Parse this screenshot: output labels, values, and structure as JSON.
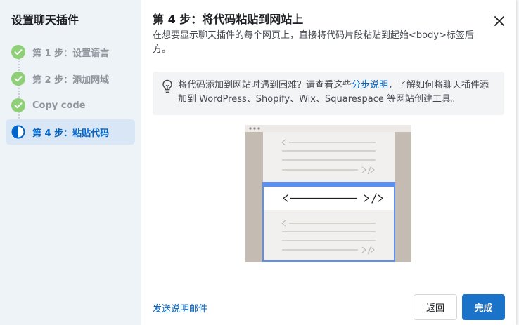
{
  "sidebar": {
    "title": "设置聊天插件",
    "steps": [
      {
        "label": "第 1 步：设置语言",
        "state": "complete"
      },
      {
        "label": "第 2 步：添加网域",
        "state": "complete"
      },
      {
        "label": "Copy code",
        "state": "complete"
      },
      {
        "label": "第 4 步：粘贴代码",
        "state": "active"
      }
    ]
  },
  "main": {
    "title": "第 4 步：将代码粘贴到网站上",
    "description": "在想要显示聊天插件的每个网页上，直接将代码片段粘贴到起始<body>标签后方。",
    "tip": {
      "text_before": "将代码添加到网站时遇到困难？请查看这些",
      "link": "分步说明",
      "text_after": "，了解如何将聊天插件添加到 WordPress、Shopify、Wix、Squarespace 等网站创建工具。"
    },
    "illustration": {
      "highlight_code": "< ———————— />"
    }
  },
  "footer": {
    "send_link": "发送说明邮件",
    "back_button": "返回",
    "done_button": "完成"
  },
  "icons": {
    "check": "check-circle-icon",
    "active": "half-circle-icon",
    "tip": "lightbulb-icon",
    "close": "close-icon"
  },
  "colors": {
    "check_green": "#8fcf78",
    "active_blue": "#0064c8",
    "primary_button": "#1a73c8",
    "link": "#0064c8",
    "illustration_highlight": "#5b8ff0"
  }
}
